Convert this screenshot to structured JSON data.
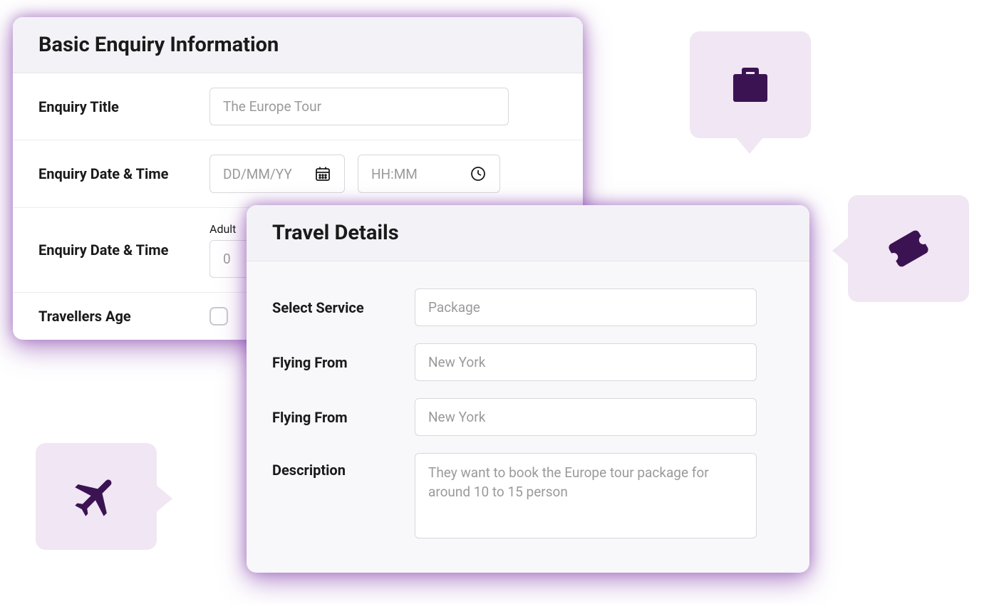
{
  "basicEnquiry": {
    "title": "Basic Enquiry Information",
    "fields": {
      "enquiryTitle": {
        "label": "Enquiry Title",
        "value": "The Europe Tour"
      },
      "dateTime": {
        "label": "Enquiry Date & Time",
        "datePlaceholder": "DD/MM/YY",
        "timePlaceholder": "HH:MM"
      },
      "party": {
        "label": "Enquiry Date & Time",
        "adultLabel": "Adult",
        "adultValue": "0"
      },
      "travellersAge": {
        "label": "Travellers Age"
      }
    }
  },
  "travelDetails": {
    "title": "Travel Details",
    "fields": {
      "service": {
        "label": "Select Service",
        "value": "Package"
      },
      "from1": {
        "label": "Flying From",
        "value": "New York"
      },
      "from2": {
        "label": "Flying From",
        "value": "New York"
      },
      "description": {
        "label": "Description",
        "value": "They want to book the Europe tour package for around 10 to 15 person"
      }
    }
  },
  "icons": {
    "calendar": "calendar-icon",
    "clock": "clock-icon",
    "luggage": "luggage-icon",
    "ticket": "ticket-icon",
    "plane": "plane-icon"
  },
  "colors": {
    "accent": "#8a3fb0",
    "iconDark": "#3b1352",
    "chipBg": "#f1e6f4"
  }
}
